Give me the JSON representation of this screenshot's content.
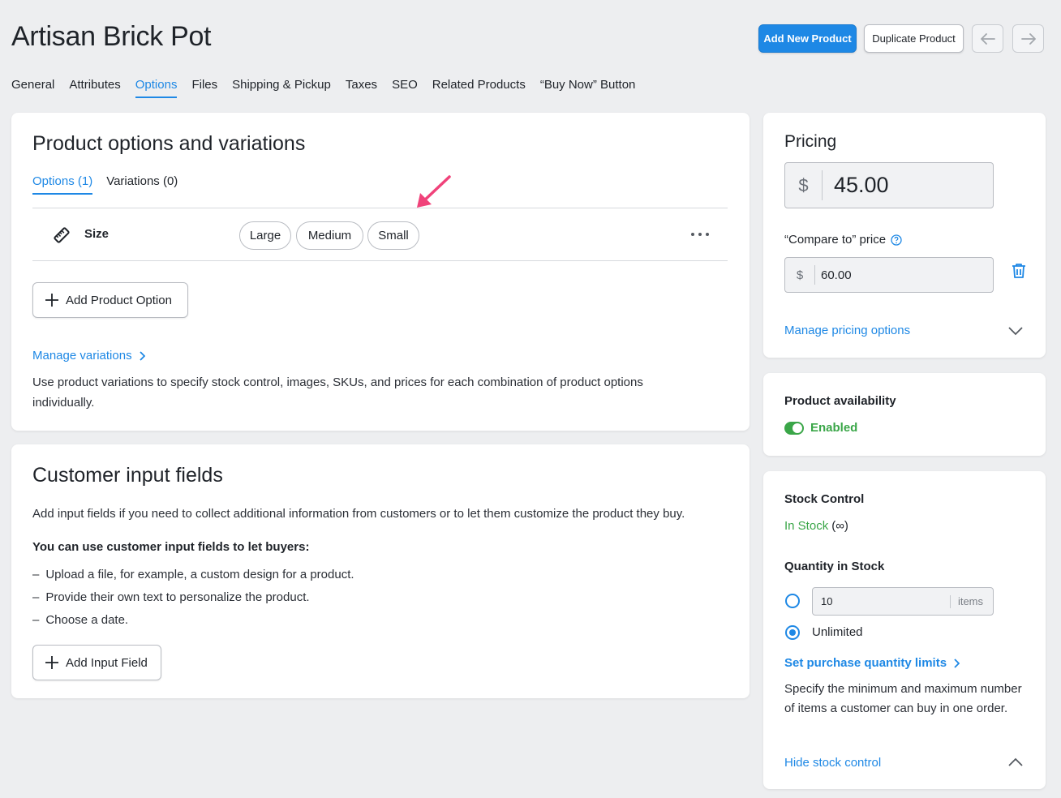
{
  "header": {
    "title": "Artisan Brick Pot",
    "add_new_label": "Add New Product",
    "duplicate_label": "Duplicate Product"
  },
  "tabs": [
    "General",
    "Attributes",
    "Options",
    "Files",
    "Shipping & Pickup",
    "Taxes",
    "SEO",
    "Related Products",
    "“Buy Now” Button"
  ],
  "active_tab": "Options",
  "options_card": {
    "title": "Product options and variations",
    "subtabs": [
      "Options (1)",
      "Variations (0)"
    ],
    "option": {
      "name": "Size",
      "values": [
        "Large",
        "Medium",
        "Small"
      ],
      "icon": "ruler-icon"
    },
    "add_option_label": "Add Product Option",
    "manage_variations_label": "Manage variations",
    "description": "Use product variations to specify stock control, images, SKUs, and prices for each combination of product options individually."
  },
  "input_fields_card": {
    "title": "Customer input fields",
    "intro": "Add input fields if you need to collect additional information from customers or to let them customize the product they buy.",
    "subheading": "You can use customer input fields to let buyers:",
    "bullets": [
      "Upload a file, for example, a custom design for a product.",
      "Provide their own text to personalize the product.",
      "Choose a date."
    ],
    "add_field_label": "Add Input Field"
  },
  "pricing": {
    "title": "Pricing",
    "currency": "$",
    "price": "45.00",
    "compare_label": "“Compare to” price",
    "compare_price": "60.00",
    "manage_label": "Manage pricing options"
  },
  "availability": {
    "title": "Product availability",
    "status": "Enabled",
    "enabled": true
  },
  "stock": {
    "title": "Stock Control",
    "status_text": "In Stock",
    "status_suffix": "(∞)",
    "quantity_label": "Quantity in Stock",
    "quantity_value": "10",
    "quantity_unit": "items",
    "unlimited_label": "Unlimited",
    "selected": "Unlimited",
    "limits_link": "Set purchase quantity limits",
    "limits_desc": "Specify the minimum and maximum number of items a customer can buy in one order.",
    "hide_label": "Hide stock control"
  },
  "colors": {
    "accent": "#1e88e5",
    "success": "#3aa648",
    "annotation_arrow": "#f0427a"
  }
}
